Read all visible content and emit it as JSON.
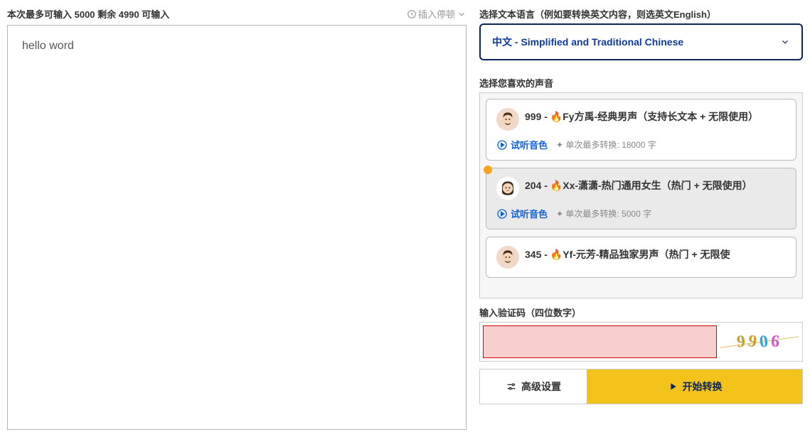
{
  "input": {
    "counter_label": "本次最多可输入 5000 剩余 4990 可输入",
    "insert_pause": "插入停顿",
    "text_value": "hello word"
  },
  "language": {
    "section_label": "选择文本语言（例如要转换英文内容，则选英文English）",
    "selected": "中文 - Simplified and Traditional Chinese"
  },
  "voices": {
    "section_label": "选择您喜欢的声音",
    "preview_label": "试听音色",
    "items": [
      {
        "id": "999",
        "name": "999 - 🔥Fy方禹-经典男声（支持长文本 + 无限使用）",
        "meta": "单次最多转换: 18000 字",
        "selected": false,
        "avatar_bg": "#f0d9c8",
        "gender": "male"
      },
      {
        "id": "204",
        "name": "204 - 🔥Xx-潇潇-热门通用女生（热门 + 无限使用）",
        "meta": "单次最多转换: 5000 字",
        "selected": true,
        "avatar_bg": "#fff",
        "gender": "female"
      },
      {
        "id": "345",
        "name": "345 - 🔥Yf-元芳-精品独家男声（热门 + 无限使",
        "meta": "",
        "selected": false,
        "avatar_bg": "#f0d9c8",
        "gender": "male"
      }
    ]
  },
  "captcha": {
    "label": "输入验证码（四位数字）",
    "value": "",
    "image_digits": [
      "9",
      "9",
      "0",
      "6"
    ]
  },
  "buttons": {
    "advanced": "高级设置",
    "convert": "开始转换"
  }
}
